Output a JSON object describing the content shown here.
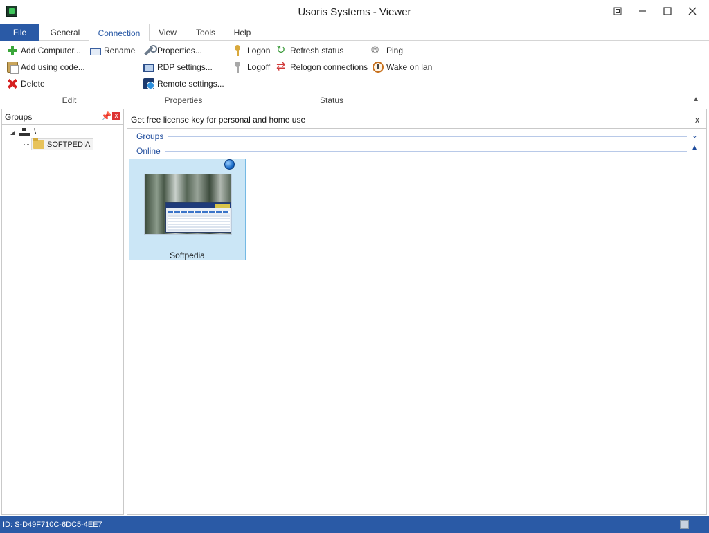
{
  "window": {
    "title": "Usoris Systems - Viewer",
    "icons": {
      "app": "app-shield-icon",
      "restore_alt": "snap-icon",
      "minimize": "minimize-icon",
      "maximize": "maximize-icon",
      "close": "close-icon"
    }
  },
  "tabs": [
    "File",
    "General",
    "Connection",
    "View",
    "Tools",
    "Help"
  ],
  "active_tab": "Connection",
  "ribbon": {
    "edit": {
      "label": "Edit",
      "add_computer": "Add Computer...",
      "rename": "Rename",
      "add_using_code": "Add using code...",
      "delete": "Delete"
    },
    "properties": {
      "label": "Properties",
      "properties": "Properties...",
      "rdp_settings": "RDP settings...",
      "remote_settings": "Remote settings..."
    },
    "status": {
      "label": "Status",
      "logon": "Logon",
      "logoff": "Logoff",
      "refresh_status": "Refresh status",
      "relogon_connections": "Relogon connections",
      "ping": "Ping",
      "wake_on_lan": "Wake on lan"
    }
  },
  "groups_panel": {
    "title": "Groups",
    "close_glyph": "x",
    "root": "\\",
    "items": [
      "SOFTPEDIA"
    ]
  },
  "main": {
    "banner": "Get free license key for personal and home use",
    "banner_close": "x",
    "sections": [
      {
        "label": "Groups",
        "expanded": false
      },
      {
        "label": "Online",
        "expanded": true
      }
    ],
    "computers": [
      {
        "name": "Softpedia",
        "selected": true,
        "status_icon": "globe-icon"
      }
    ]
  },
  "statusbar": {
    "id_text": "ID: S-D49F710C-6DC5-4EE7"
  },
  "colors": {
    "accent": "#2a5aa6",
    "selection_bg": "#cbe6f6",
    "selection_border": "#74b9e4",
    "section_text": "#1e4b9c"
  }
}
